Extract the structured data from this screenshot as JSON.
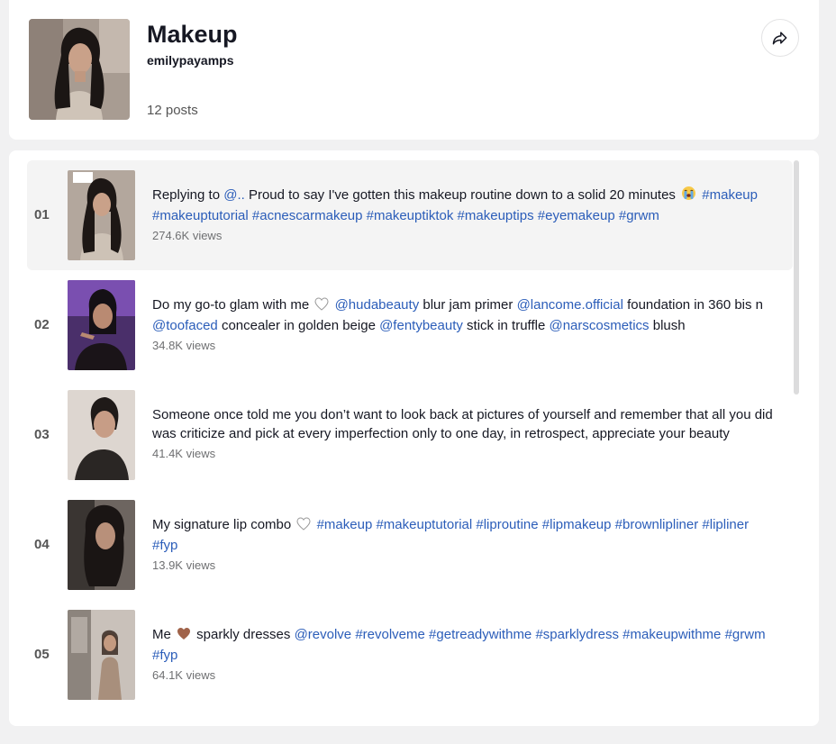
{
  "playlist": {
    "title": "Makeup",
    "username": "emilypayamps",
    "post_count": "12 posts",
    "share_icon": "share-icon"
  },
  "videos": [
    {
      "index": "01",
      "caption": [
        {
          "t": "text",
          "v": "Replying to "
        },
        {
          "t": "mention",
          "v": "@.."
        },
        {
          "t": "text",
          "v": " Proud to say I've gotten this makeup routine down to a solid 20 minutes "
        },
        {
          "t": "emoji",
          "v": "loudly-crying-face-emoji"
        },
        {
          "t": "text",
          "v": " "
        },
        {
          "t": "tag",
          "v": "#makeup"
        },
        {
          "t": "text",
          "v": " "
        },
        {
          "t": "tag",
          "v": "#makeuptutorial"
        },
        {
          "t": "text",
          "v": " "
        },
        {
          "t": "tag",
          "v": "#acnescarmakeup"
        },
        {
          "t": "text",
          "v": " "
        },
        {
          "t": "tag",
          "v": "#makeuptiktok"
        },
        {
          "t": "text",
          "v": " "
        },
        {
          "t": "tag",
          "v": "#makeuptips"
        },
        {
          "t": "text",
          "v": " "
        },
        {
          "t": "tag",
          "v": "#eyemakeup"
        },
        {
          "t": "text",
          "v": " "
        },
        {
          "t": "tag",
          "v": "#grwm"
        }
      ],
      "views": "274.6K views"
    },
    {
      "index": "02",
      "caption": [
        {
          "t": "text",
          "v": "Do my go-to glam with me "
        },
        {
          "t": "emoji",
          "v": "white-heart-emoji"
        },
        {
          "t": "text",
          "v": " "
        },
        {
          "t": "mention",
          "v": "@hudabeauty"
        },
        {
          "t": "text",
          "v": " blur jam primer "
        },
        {
          "t": "mention",
          "v": "@lancome.official"
        },
        {
          "t": "text",
          "v": " foundation in 360 bis n "
        },
        {
          "t": "mention",
          "v": "@toofaced"
        },
        {
          "t": "text",
          "v": " concealer in golden beige "
        },
        {
          "t": "mention",
          "v": "@fentybeauty"
        },
        {
          "t": "text",
          "v": " stick in truffle "
        },
        {
          "t": "mention",
          "v": "@narscosmetics"
        },
        {
          "t": "text",
          "v": " blush"
        }
      ],
      "views": "34.8K views"
    },
    {
      "index": "03",
      "caption": [
        {
          "t": "text",
          "v": "Someone once told me you don’t want to look back at pictures of yourself and remember that all you did was criticize and pick at every imperfection only to one day, in retrospect, appreciate your beauty"
        }
      ],
      "views": "41.4K views"
    },
    {
      "index": "04",
      "caption": [
        {
          "t": "text",
          "v": "My signature lip combo "
        },
        {
          "t": "emoji",
          "v": "white-heart-emoji"
        },
        {
          "t": "text",
          "v": " "
        },
        {
          "t": "tag",
          "v": "#makeup"
        },
        {
          "t": "text",
          "v": " "
        },
        {
          "t": "tag",
          "v": "#makeuptutorial"
        },
        {
          "t": "text",
          "v": " "
        },
        {
          "t": "tag",
          "v": "#liproutine"
        },
        {
          "t": "text",
          "v": " "
        },
        {
          "t": "tag",
          "v": "#lipmakeup"
        },
        {
          "t": "text",
          "v": " "
        },
        {
          "t": "tag",
          "v": "#brownlipliner"
        },
        {
          "t": "text",
          "v": " "
        },
        {
          "t": "tag",
          "v": "#lipliner"
        },
        {
          "t": "text",
          "v": " "
        },
        {
          "t": "tag",
          "v": "#fyp"
        }
      ],
      "views": "13.9K views"
    },
    {
      "index": "05",
      "caption": [
        {
          "t": "text",
          "v": "Me "
        },
        {
          "t": "emoji",
          "v": "brown-heart-emoji"
        },
        {
          "t": "text",
          "v": " sparkly dresses "
        },
        {
          "t": "mention",
          "v": "@revolve"
        },
        {
          "t": "text",
          "v": " "
        },
        {
          "t": "tag",
          "v": "#revolveme"
        },
        {
          "t": "text",
          "v": " "
        },
        {
          "t": "tag",
          "v": "#getreadywithme"
        },
        {
          "t": "text",
          "v": " "
        },
        {
          "t": "tag",
          "v": "#sparklydress"
        },
        {
          "t": "text",
          "v": " "
        },
        {
          "t": "tag",
          "v": "#makeupwithme"
        },
        {
          "t": "text",
          "v": " "
        },
        {
          "t": "tag",
          "v": "#grwm"
        },
        {
          "t": "text",
          "v": " "
        },
        {
          "t": "tag",
          "v": "#fyp"
        }
      ],
      "views": "64.1K views"
    }
  ],
  "colors": {
    "link": "#2b5db9",
    "active_row": "#f4f4f4",
    "background": "#f1f1f2"
  }
}
